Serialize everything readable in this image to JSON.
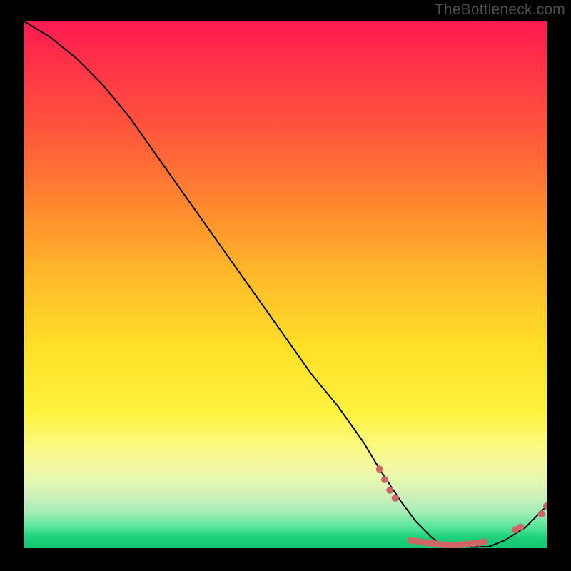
{
  "watermark": "TheBottleneck.com",
  "colors": {
    "curve": "#000000",
    "marker": "#cf6564",
    "background_black": "#000000"
  },
  "chart_data": {
    "type": "line",
    "title": "",
    "xlabel": "",
    "ylabel": "",
    "xlim": [
      0,
      100
    ],
    "ylim": [
      0,
      100
    ],
    "series": [
      {
        "name": "bottleneck-curve",
        "x": [
          0,
          5,
          10,
          15,
          20,
          25,
          30,
          35,
          40,
          45,
          50,
          55,
          60,
          65,
          68,
          72,
          75,
          78,
          80,
          83,
          86,
          89,
          92,
          96,
          100
        ],
        "y": [
          100,
          97,
          93,
          88,
          82,
          75,
          68,
          61,
          54,
          47,
          40,
          33,
          27,
          20,
          15,
          9,
          5,
          2,
          0.7,
          0.3,
          0.2,
          0.3,
          1.5,
          4,
          8
        ]
      }
    ],
    "markers": [
      {
        "x": 68.0,
        "y": 15.0
      },
      {
        "x": 69.0,
        "y": 13.0
      },
      {
        "x": 70.0,
        "y": 11.0
      },
      {
        "x": 71.0,
        "y": 9.5
      },
      {
        "x": 74.0,
        "y": 1.5
      },
      {
        "x": 75.0,
        "y": 1.3
      },
      {
        "x": 76.0,
        "y": 1.2
      },
      {
        "x": 77.0,
        "y": 1.0
      },
      {
        "x": 78.0,
        "y": 0.9
      },
      {
        "x": 79.0,
        "y": 0.8
      },
      {
        "x": 80.0,
        "y": 0.7
      },
      {
        "x": 81.0,
        "y": 0.6
      },
      {
        "x": 82.0,
        "y": 0.6
      },
      {
        "x": 83.0,
        "y": 0.6
      },
      {
        "x": 84.0,
        "y": 0.7
      },
      {
        "x": 85.0,
        "y": 0.8
      },
      {
        "x": 86.0,
        "y": 0.9
      },
      {
        "x": 87.0,
        "y": 1.0
      },
      {
        "x": 88.0,
        "y": 1.2
      },
      {
        "x": 94.0,
        "y": 3.5
      },
      {
        "x": 95.0,
        "y": 4.0
      },
      {
        "x": 99.0,
        "y": 6.5
      },
      {
        "x": 100.0,
        "y": 8.0
      }
    ]
  }
}
